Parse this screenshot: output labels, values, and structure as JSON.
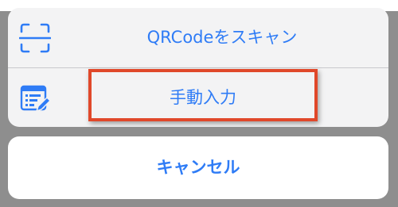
{
  "action_sheet": {
    "items": [
      {
        "label": "QRCodeをスキャン",
        "icon": "qr-scan-icon"
      },
      {
        "label": "手動入力",
        "icon": "manual-input-icon"
      }
    ],
    "cancel_label": "キャンセル"
  },
  "colors": {
    "accent": "#2f7cf6",
    "highlight": "#e0482a",
    "backdrop": "#8e8e8e",
    "sheet": "#f3f3f4"
  }
}
